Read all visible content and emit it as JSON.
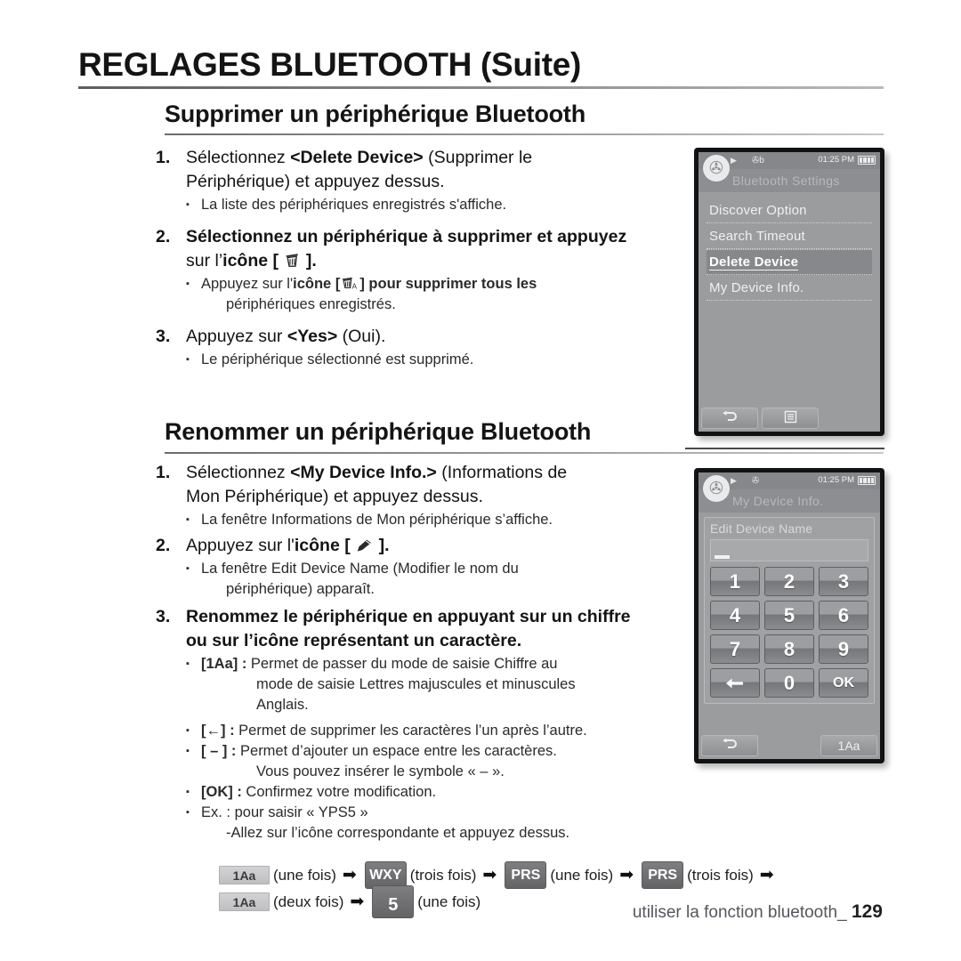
{
  "chapter": {
    "title": "REGLAGES BLUETOOTH (Suite)"
  },
  "sections": [
    {
      "heading": "Supprimer un périphérique Bluetooth",
      "steps": [
        {
          "num": "1.",
          "text_parts": [
            {
              "t": "Sélectionnez ",
              "bold": false
            },
            {
              "t": "<Delete Device>",
              "bold": true
            },
            {
              "t": " (Supprimer le Périphérique) et appuyez dessus.",
              "bold": false
            }
          ],
          "bullets": [
            {
              "text": "La liste des périphériques enregistrés s'affiche."
            }
          ]
        },
        {
          "num": "2.",
          "text_parts": [
            {
              "t": "Sélectionnez un périphérique à supprimer et appuyez sur l’",
              "bold": false
            },
            {
              "t": "icône",
              "bold": true
            },
            {
              "t": " [ ",
              "bold": true
            },
            {
              "t": "trash-icon",
              "bold": true
            },
            {
              "t": " ].",
              "bold": true
            }
          ],
          "bullets": [
            {
              "text": "Appuyez sur l'icône [ trash-all-icon ] pour supprimer tous les périphériques enregistrés."
            }
          ]
        },
        {
          "num": "3.",
          "text_parts": [
            {
              "t": "Appuyez sur ",
              "bold": false
            },
            {
              "t": "<Yes>",
              "bold": true
            },
            {
              "t": " (Oui).",
              "bold": false
            }
          ],
          "bullets": [
            {
              "text": "Le périphérique sélectionné est supprimé."
            }
          ]
        }
      ]
    },
    {
      "heading": "Renommer un périphérique Bluetooth"
    }
  ],
  "step1_1_a": "Sélectionnez ",
  "step1_1_b": "<Delete Device>",
  "step1_1_c": " (Supprimer le",
  "step1_1_d": "Périphérique) et appuyez dessus.",
  "step1_1_bullet": "La liste des périphériques enregistrés s'affiche.",
  "step1_2_a": "Sélectionnez un périphérique à supprimer et appuyez",
  "step1_2_b": "sur l’",
  "step1_2_c": "icône",
  "step1_2_d": "[",
  "step1_2_e": "].",
  "step1_2_bullet_a": "Appuyez sur l'",
  "step1_2_bullet_b": "icône",
  "step1_2_bullet_c": "[",
  "step1_2_bullet_d": "] pour supprimer tous les",
  "step1_2_bullet_e": "périphériques enregistrés.",
  "step1_3_a": "Appuyez sur ",
  "step1_3_b": "<Yes>",
  "step1_3_c": " (Oui).",
  "step1_3_bullet": "Le périphérique sélectionné est supprimé.",
  "step2_1_a": "Sélectionnez ",
  "step2_1_b": "<My Device Info.>",
  "step2_1_c": " (Informations de",
  "step2_1_d": "Mon Périphérique) et appuyez dessus.",
  "step2_1_bullet": "La fenêtre Informations de Mon périphérique s’affiche.",
  "step2_2_a": "Appuyez sur l'",
  "step2_2_b": "icône",
  "step2_2_c": "[",
  "step2_2_d": "].",
  "step2_2_bullet_a": "La fenêtre Edit Device Name (Modifier le nom du",
  "step2_2_bullet_b": "périphérique) apparaît.",
  "step2_3_a": "Renommez le périphérique en appuyant sur un chiffre",
  "step2_3_b": "ou sur l’icône représentant un caractère.",
  "step2_3_bullets": {
    "b1_key": "[1Aa] :",
    "b1_text": " Permet de passer du mode de saisie Chiffre au",
    "b1_cont_1": "mode de saisie Lettres majuscules et minuscules",
    "b1_cont_2": "Anglais.",
    "b2_key": "[←] :",
    "b2_text": " Permet de supprimer les caractères l’un après l’autre.",
    "b3_key": "[ – ] :",
    "b3_text": " Permet d’ajouter un espace entre les caractères.",
    "b3_cont": "Vous pouvez insérer le symbole « – ».",
    "b4_key": "[OK] :",
    "b4_text": " Confirmez votre modification.",
    "b5_text": "Ex. : pour saisir « YPS5 »",
    "b5_cont": "-Allez sur l’icône correspondante et appuyez dessus."
  },
  "key_sequence": {
    "row1": [
      {
        "type": "badge-light",
        "label": "1Aa"
      },
      {
        "type": "text",
        "label": "(une fois)"
      },
      {
        "type": "arrow",
        "label": "➡"
      },
      {
        "type": "badge-dark",
        "label": "WXY"
      },
      {
        "type": "text",
        "label": "(trois fois)"
      },
      {
        "type": "arrow",
        "label": "➡"
      },
      {
        "type": "badge-dark",
        "label": "PRS"
      },
      {
        "type": "text",
        "label": "(une fois)"
      },
      {
        "type": "arrow",
        "label": "➡"
      },
      {
        "type": "badge-dark",
        "label": "PRS"
      },
      {
        "type": "text",
        "label": "(trois fois)"
      },
      {
        "type": "arrow",
        "label": "➡"
      }
    ],
    "row2": [
      {
        "type": "badge-light",
        "label": "1Aa"
      },
      {
        "type": "text",
        "label": "(deux fois)"
      },
      {
        "type": "arrow",
        "label": "➡"
      },
      {
        "type": "badge-dark-num",
        "label": "5"
      },
      {
        "type": "text",
        "label": "(une fois)"
      }
    ]
  },
  "footer": {
    "text": "utiliser la fonction bluetooth_",
    "page": "129"
  },
  "device1": {
    "status": {
      "time": "01:25 PM",
      "play_icon": "play-icon",
      "bt_icon": "bluetooth-b-icon",
      "battery_icon": "battery-full-icon"
    },
    "title": "Bluetooth Settings",
    "menu": [
      {
        "label": "Discover Option",
        "selected": false
      },
      {
        "label": "Search Timeout",
        "selected": false
      },
      {
        "label": "Delete Device",
        "selected": true
      },
      {
        "label": "My Device Info.",
        "selected": false
      }
    ],
    "softkeys": [
      {
        "icon": "back-arrow-icon"
      },
      {
        "icon": "menu-list-icon"
      }
    ]
  },
  "device2": {
    "status": {
      "time": "01:25 PM",
      "play_icon": "play-icon",
      "bt_icon": "bluetooth-icon",
      "battery_icon": "battery-full-icon"
    },
    "title": "My Device Info.",
    "dialog_title": "Edit Device Name",
    "input_value": "",
    "keypad": [
      "1",
      "2",
      "3",
      "4",
      "5",
      "6",
      "7",
      "8",
      "9",
      "backspace-icon",
      "0",
      "OK"
    ],
    "softkeys": [
      {
        "icon": "back-arrow-icon"
      },
      {
        "label": "1Aa"
      }
    ]
  },
  "colors": {
    "rule": "#5d5d5d",
    "screen_bg": "#9b9c9e",
    "text": "#141414",
    "footer": "#55565c"
  }
}
